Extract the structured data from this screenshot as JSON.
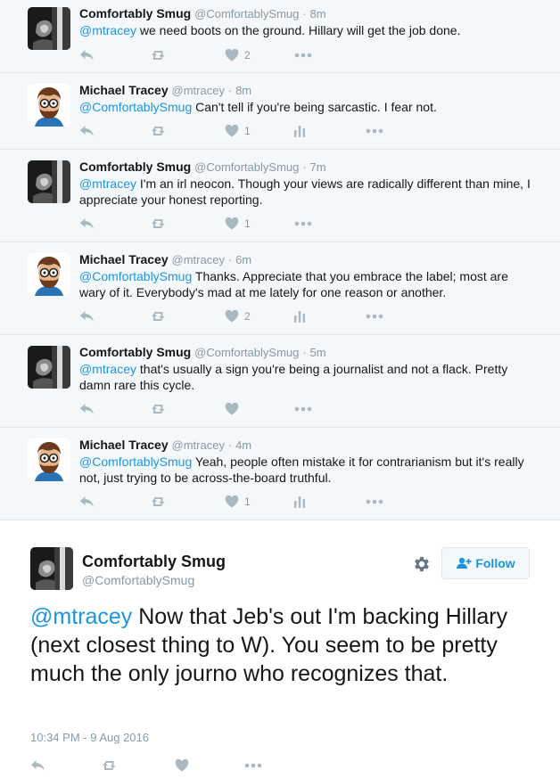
{
  "thread": [
    {
      "author": "Comfortably Smug",
      "handle": "@ComfortablySmug",
      "sep": "·",
      "time": "8m",
      "mention": "@mtracey",
      "body": " we need boots on the ground. Hillary will get the job done.",
      "likes": "2",
      "avatar": "smug"
    },
    {
      "author": "Michael Tracey",
      "handle": "@mtracey",
      "sep": "·",
      "time": "8m",
      "mention": "@ComfortablySmug",
      "body": " Can't tell if you're being sarcastic. I fear not.",
      "likes": "1",
      "avatar": "tracey"
    },
    {
      "author": "Comfortably Smug",
      "handle": "@ComfortablySmug",
      "sep": "·",
      "time": "7m",
      "mention": "@mtracey",
      "body": " I'm an irl neocon. Though your views are radically different than mine, I appreciate your honest reporting.",
      "likes": "1",
      "avatar": "smug"
    },
    {
      "author": "Michael Tracey",
      "handle": "@mtracey",
      "sep": "·",
      "time": "6m",
      "mention": "@ComfortablySmug",
      "body": " Thanks. Appreciate that you embrace the label; most are wary of it. Everybody's mad at me lately for one reason or another.",
      "likes": "2",
      "avatar": "tracey"
    },
    {
      "author": "Comfortably Smug",
      "handle": "@ComfortablySmug",
      "sep": "·",
      "time": "5m",
      "mention": "@mtracey",
      "body": " that's usually a sign you're being a journalist and not a flack. Pretty damn rare this cycle.",
      "likes": "",
      "avatar": "smug"
    },
    {
      "author": "Michael Tracey",
      "handle": "@mtracey",
      "sep": "·",
      "time": "4m",
      "mention": "@ComfortablySmug",
      "body": " Yeah, people often mistake it for contrarianism but it's really not, just trying to be across-the-board truthful.",
      "likes": "1",
      "avatar": "tracey"
    }
  ],
  "main_tweet": {
    "author": "Comfortably Smug",
    "handle": "@ComfortablySmug",
    "follow_label": "Follow",
    "mention": "@mtracey",
    "body": " Now that Jeb's out I'm backing Hillary (next closest thing to W). You seem to be pretty much the only journo who recognizes that.",
    "timestamp": "10:34 PM - 9 Aug 2016"
  },
  "icons": {
    "reply": "reply-icon",
    "retweet": "retweet-icon",
    "like": "heart-icon",
    "analytics": "analytics-icon",
    "more": "more-icon",
    "gear": "gear-icon",
    "follow": "add-user-icon"
  },
  "colors": {
    "accent": "#1b95e0",
    "muted": "#8899a6",
    "thread_bg": "#f5f8fa",
    "divider": "#e1e8ed",
    "icon": "#aab8c2"
  }
}
